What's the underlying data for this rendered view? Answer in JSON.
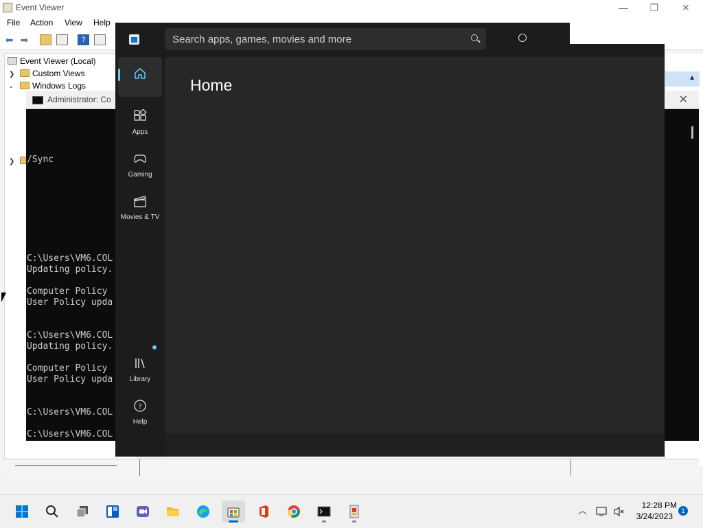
{
  "event_viewer": {
    "title": "Event Viewer",
    "menu": [
      "File",
      "Action",
      "View",
      "Help"
    ],
    "tree": {
      "root": "Event Viewer (Local)",
      "custom_views": "Custom Views",
      "windows_logs": "Windows Logs"
    },
    "window_controls": {
      "minimize": "—",
      "restore": "❐",
      "close": "✕"
    }
  },
  "cmd": {
    "title": "Administrator: Co",
    "lines": [
      "/Sync",
      "C:\\Users\\VM6.COL",
      "Updating policy.",
      "Computer Policy",
      "User Policy upda",
      "C:\\Users\\VM6.COL",
      "Updating policy.",
      "Computer Policy",
      "User Policy upda",
      "C:\\Users\\VM6.COL",
      "C:\\Users\\VM6.COL"
    ]
  },
  "store": {
    "search_placeholder": "Search apps, games, movies and more",
    "page_title": "Home",
    "nav": [
      {
        "label": "",
        "icon": "home-icon",
        "active": true
      },
      {
        "label": "Apps",
        "icon": "apps-icon"
      },
      {
        "label": "Gaming",
        "icon": "gaming-icon"
      },
      {
        "label": "Movies & TV",
        "icon": "movies-icon"
      }
    ],
    "nav_bottom": [
      {
        "label": "Library",
        "icon": "library-icon"
      },
      {
        "label": "Help",
        "icon": "help-icon"
      }
    ],
    "accent": "#60cdff"
  },
  "taskbar": {
    "apps": [
      "start-icon",
      "search-icon",
      "task-view-icon",
      "widgets-icon",
      "chat-icon",
      "file-explorer-icon",
      "edge-icon",
      "store-icon",
      "office-icon",
      "chrome-icon",
      "terminal-icon",
      "event-viewer-icon"
    ],
    "time": "12:28 PM",
    "date": "3/24/2023",
    "notification_count": "1"
  }
}
